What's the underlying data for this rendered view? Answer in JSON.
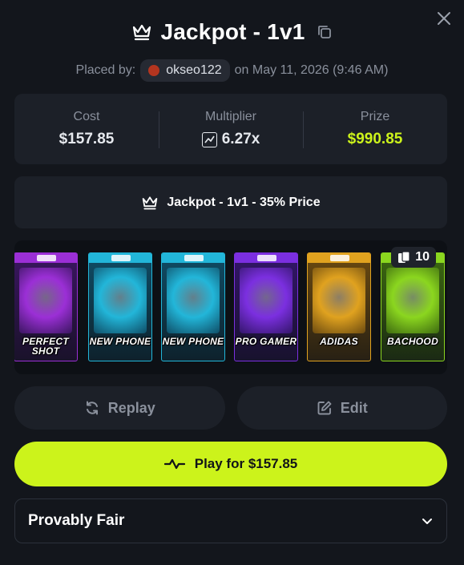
{
  "header": {
    "title": "Jackpot - 1v1"
  },
  "placed": {
    "prefix": "Placed by:",
    "username": "okseo122",
    "date_text": "on May 11, 2026 (9:46 AM)"
  },
  "stats": [
    {
      "label": "Cost",
      "value": "$157.85"
    },
    {
      "label": "Multiplier",
      "value": "6.27x"
    },
    {
      "label": "Prize",
      "value": "$990.85"
    }
  ],
  "mode": {
    "label": "Jackpot - 1v1 - 35% Price"
  },
  "packs": {
    "count": "10",
    "items": [
      {
        "name": "PERFECT SHOT",
        "band": "#9b2fd6",
        "bg": "#3a1660"
      },
      {
        "name": "NEW PHONE",
        "band": "#22b6d9",
        "bg": "#0f4d66"
      },
      {
        "name": "NEW PHONE",
        "band": "#22b6d9",
        "bg": "#0f4d66"
      },
      {
        "name": "PRO GAMER",
        "band": "#7b2fe0",
        "bg": "#33166a"
      },
      {
        "name": "ADIDAS",
        "band": "#e0a21f",
        "bg": "#6b4a10"
      },
      {
        "name": "BACHOOD",
        "band": "#8bd61f",
        "bg": "#3d6a10"
      }
    ]
  },
  "actions": {
    "replay": "Replay",
    "edit": "Edit",
    "play": "Play for $157.85"
  },
  "fair": {
    "label": "Provably Fair"
  },
  "colors": {
    "accent": "#ccf31b",
    "panel": "#1c2028",
    "background": "#13161c"
  }
}
